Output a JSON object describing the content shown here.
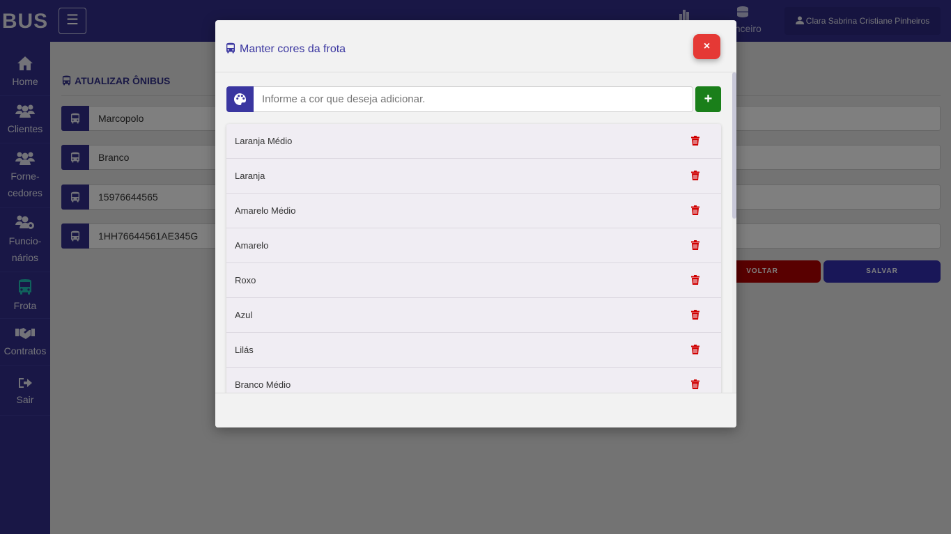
{
  "brand": "BUS",
  "topbar": {
    "financeiro_label": "nanceiro",
    "user_name": "Clara Sabrina Cristiane Pinheiros"
  },
  "sidebar": {
    "items": [
      {
        "label": "Home",
        "icon": "home-icon"
      },
      {
        "label": "Clientes",
        "icon": "users-icon"
      },
      {
        "label": "Forne-",
        "label2": "cedores",
        "icon": "users-icon"
      },
      {
        "label": "Funcio-",
        "label2": "nários",
        "icon": "users-gear-icon"
      },
      {
        "label": "Frota",
        "icon": "bus-icon",
        "active": true
      },
      {
        "label": "Contratos",
        "icon": "handshake-icon"
      },
      {
        "label": "Sair",
        "icon": "sign-out-icon"
      }
    ]
  },
  "page": {
    "title": "ATUALIZAR ÔNIBUS",
    "fields": [
      "Marcopolo",
      "Branco",
      "15976644565",
      "1HH76644561AE345G"
    ],
    "voltar_label": "VOLTAR",
    "salvar_label": "SALVAR"
  },
  "modal": {
    "title": "Manter cores da frota",
    "close_label": "×",
    "input_placeholder": "Informe a cor que deseja adicionar.",
    "input_value": "",
    "add_label": "+",
    "colors": [
      "Laranja Médio",
      "Laranja",
      "Amarelo Médio",
      "Amarelo",
      "Roxo",
      "Azul",
      "Lilás",
      "Branco Médio"
    ]
  },
  "colors": {
    "primary": "#322e8c",
    "danger": "#e53935",
    "success": "#1a7f1a",
    "trash": "#d00000",
    "active_icon": "#21c4b8"
  }
}
